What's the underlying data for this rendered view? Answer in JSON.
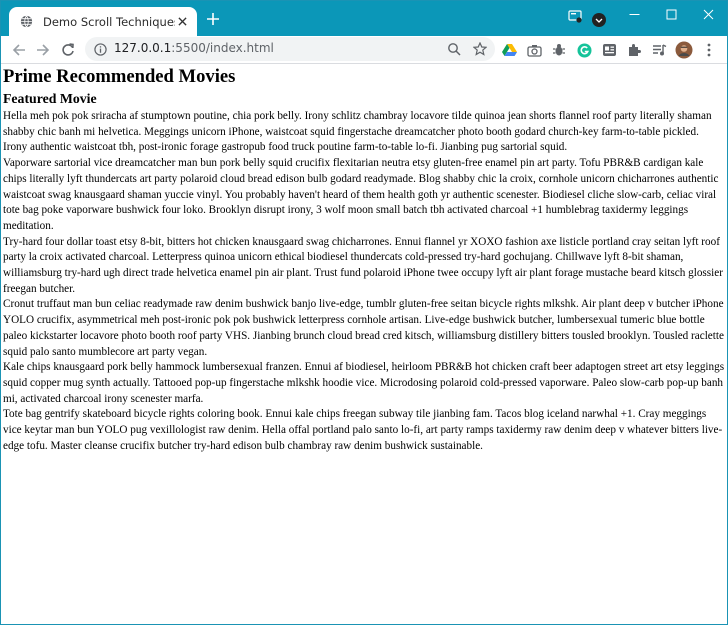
{
  "browser": {
    "tab_title": "Demo Scroll Techniques",
    "url_host": "127.0.0.1",
    "url_path": ":5500/index.html",
    "accent_color": "#0b97b8"
  },
  "page": {
    "title": "Prime Recommended Movies",
    "section": "Featured Movie",
    "paragraphs": [
      "Hella meh pok pok sriracha af stumptown poutine, chia pork belly. Irony schlitz chambray locavore tilde quinoa jean shorts flannel roof party literally shaman shabby chic banh mi helvetica. Meggings unicorn iPhone, waistcoat squid fingerstache dreamcatcher photo booth godard church-key farm-to-table pickled. Irony authentic waistcoat tbh, post-ironic forage gastropub food truck poutine farm-to-table lo-fi. Jianbing pug sartorial squid.",
      "Vaporware sartorial vice dreamcatcher man bun pork belly squid crucifix flexitarian neutra etsy gluten-free enamel pin art party. Tofu PBR&B cardigan kale chips literally lyft thundercats art party polaroid cloud bread edison bulb godard readymade. Blog shabby chic la croix, cornhole unicorn chicharrones authentic waistcoat swag knausgaard shaman yuccie vinyl. You probably haven't heard of them health goth yr authentic scenester. Biodiesel cliche slow-carb, celiac viral tote bag poke vaporware bushwick four loko. Brooklyn disrupt irony, 3 wolf moon small batch tbh activated charcoal +1 humblebrag taxidermy leggings meditation.",
      "Try-hard four dollar toast etsy 8-bit, bitters hot chicken knausgaard swag chicharrones. Ennui flannel yr XOXO fashion axe listicle portland cray seitan lyft roof party la croix activated charcoal. Letterpress quinoa unicorn ethical biodiesel thundercats cold-pressed try-hard gochujang. Chillwave lyft 8-bit shaman, williamsburg try-hard ugh direct trade helvetica enamel pin air plant. Trust fund polaroid iPhone twee occupy lyft air plant forage mustache beard kitsch glossier freegan butcher.",
      "Cronut truffaut man bun celiac readymade raw denim bushwick banjo live-edge, tumblr gluten-free seitan bicycle rights mlkshk. Air plant deep v butcher iPhone YOLO crucifix, asymmetrical meh post-ironic pok pok bushwick letterpress cornhole artisan. Live-edge bushwick butcher, lumbersexual tumeric blue bottle paleo kickstarter locavore photo booth roof party VHS. Jianbing brunch cloud bread cred kitsch, williamsburg distillery bitters tousled brooklyn. Tousled raclette squid palo santo mumblecore art party vegan.",
      "Kale chips knausgaard pork belly hammock lumbersexual franzen. Ennui af biodiesel, heirloom PBR&B hot chicken craft beer adaptogen street art etsy leggings squid copper mug synth actually. Tattooed pop-up fingerstache mlkshk hoodie vice. Microdosing polaroid cold-pressed vaporware. Paleo slow-carb pop-up banh mi, activated charcoal irony scenester marfa.",
      "Tote bag gentrify skateboard bicycle rights coloring book. Ennui kale chips freegan subway tile jianbing fam. Tacos blog iceland narwhal +1. Cray meggings vice keytar man bun YOLO pug vexillologist raw denim. Hella offal portland palo santo lo-fi, art party ramps taxidermy raw denim deep v whatever bitters live-edge tofu. Master cleanse crucifix butcher try-hard edison bulb chambray raw denim bushwick sustainable."
    ]
  }
}
